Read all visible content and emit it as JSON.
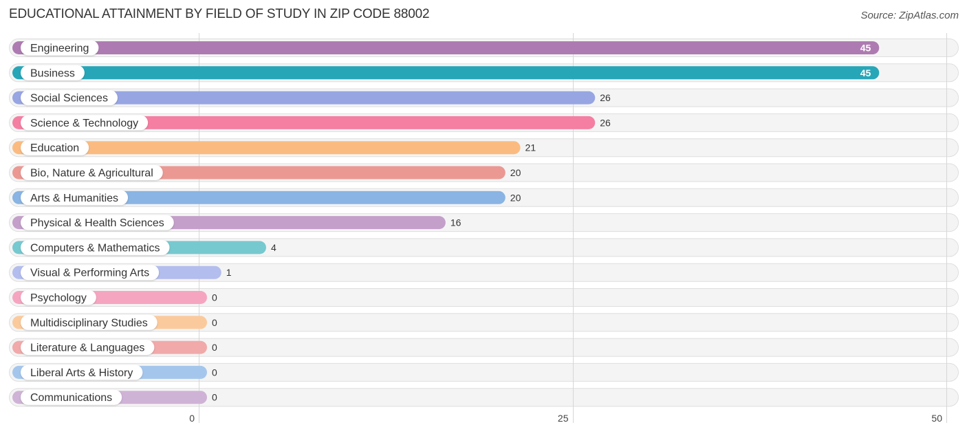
{
  "chart_data": {
    "type": "bar",
    "orientation": "horizontal",
    "title": "EDUCATIONAL ATTAINMENT BY FIELD OF STUDY IN ZIP CODE 88002",
    "source": "Source: ZipAtlas.com",
    "xlabel": "",
    "ylabel": "",
    "xlim": [
      0,
      50
    ],
    "xticks": [
      0,
      25,
      50
    ],
    "grid": true,
    "categories": [
      "Engineering",
      "Business",
      "Social Sciences",
      "Science & Technology",
      "Education",
      "Bio, Nature & Agricultural",
      "Arts & Humanities",
      "Physical & Health Sciences",
      "Computers & Mathematics",
      "Visual & Performing Arts",
      "Psychology",
      "Multidisciplinary Studies",
      "Literature & Languages",
      "Liberal Arts & History",
      "Communications"
    ],
    "values": [
      45,
      45,
      26,
      26,
      21,
      20,
      20,
      16,
      4,
      1,
      0,
      0,
      0,
      0,
      0
    ],
    "colors": [
      "#ad7bb1",
      "#27a6b8",
      "#97a5e3",
      "#f47fa3",
      "#fbbb80",
      "#eb9893",
      "#89b4e3",
      "#c39fc9",
      "#76c9cf",
      "#b3bdee",
      "#f6a5c0",
      "#fbca9c",
      "#f1a9a9",
      "#a5c6ec",
      "#cfb3d6"
    ]
  }
}
